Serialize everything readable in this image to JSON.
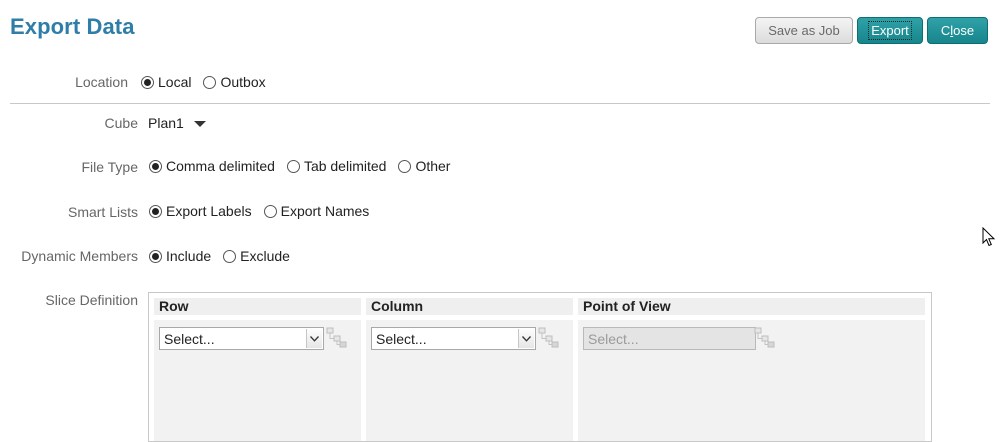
{
  "header": {
    "title": "Export Data",
    "buttons": {
      "save_as_job": "Save as Job",
      "export": "Export",
      "close_prefix": "C",
      "close_underlined": "l",
      "close_suffix": "ose"
    }
  },
  "location": {
    "label": "Location",
    "options": [
      {
        "label": "Local",
        "selected": true
      },
      {
        "label": "Outbox",
        "selected": false
      }
    ]
  },
  "cube": {
    "label": "Cube",
    "value": "Plan1"
  },
  "file_type": {
    "label": "File Type",
    "options": [
      {
        "label": "Comma delimited",
        "selected": true
      },
      {
        "label": "Tab delimited",
        "selected": false
      },
      {
        "label": "Other",
        "selected": false
      }
    ]
  },
  "smart_lists": {
    "label": "Smart Lists",
    "options": [
      {
        "label": "Export Labels",
        "selected": true
      },
      {
        "label": "Export Names",
        "selected": false
      }
    ]
  },
  "dynamic_members": {
    "label": "Dynamic Members",
    "options": [
      {
        "label": "Include",
        "selected": true
      },
      {
        "label": "Exclude",
        "selected": false
      }
    ]
  },
  "slice": {
    "label": "Slice Definition",
    "columns": [
      {
        "header": "Row",
        "select_value": "Select...",
        "disabled": false
      },
      {
        "header": "Column",
        "select_value": "Select...",
        "disabled": false
      },
      {
        "header": "Point of View",
        "select_value": "Select...",
        "disabled": true
      }
    ]
  },
  "icons": {
    "dropdown": "chevron-down-icon",
    "member_selector": "member-selector-icon",
    "cube_caret": "caret-down-icon",
    "cursor": "mouse-pointer-icon"
  },
  "colors": {
    "title": "#2e7ea8",
    "accent_button": "#1f939a"
  }
}
